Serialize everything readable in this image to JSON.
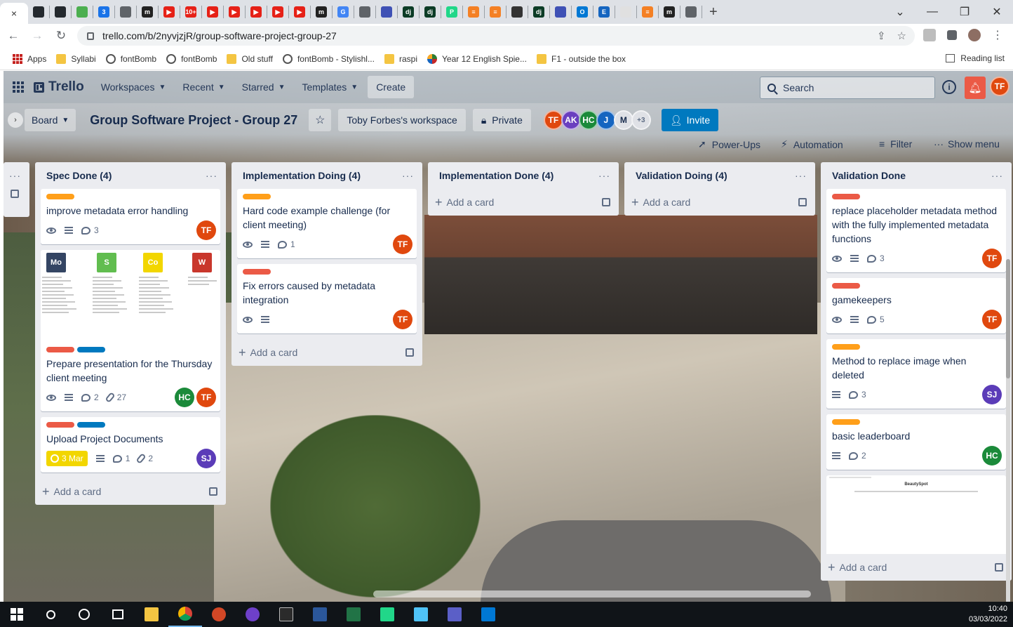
{
  "browser": {
    "active_tab_close": "×",
    "new_tab": "+",
    "window_controls": [
      "⌄",
      "—",
      "❐",
      "✕"
    ],
    "url": "trello.com/b/2nyvjzjR/group-software-project-group-27",
    "tab_icons": [
      {
        "name": "github-icon",
        "color": "#24292e",
        "text": ""
      },
      {
        "name": "github-icon",
        "color": "#24292e",
        "text": ""
      },
      {
        "name": "chrome-icon",
        "color": "#4caf50",
        "text": ""
      },
      {
        "name": "calendar-icon",
        "color": "#1a73e8",
        "text": "3"
      },
      {
        "name": "globe-icon",
        "color": "#5f6368",
        "text": ""
      },
      {
        "name": "medium-icon",
        "color": "#222222",
        "text": "m"
      },
      {
        "name": "youtube-icon",
        "color": "#e62117",
        "text": "▶"
      },
      {
        "name": "youtube-badge-icon",
        "color": "#e62117",
        "text": "10+"
      },
      {
        "name": "youtube-icon",
        "color": "#e62117",
        "text": "▶"
      },
      {
        "name": "youtube-icon",
        "color": "#e62117",
        "text": "▶"
      },
      {
        "name": "youtube-icon",
        "color": "#e62117",
        "text": "▶"
      },
      {
        "name": "youtube-icon",
        "color": "#e62117",
        "text": "▶"
      },
      {
        "name": "youtube-icon",
        "color": "#e62117",
        "text": "▶"
      },
      {
        "name": "medium-icon",
        "color": "#222222",
        "text": "m"
      },
      {
        "name": "google-icon",
        "color": "#4285f4",
        "text": "G"
      },
      {
        "name": "globe-icon",
        "color": "#5f6368",
        "text": ""
      },
      {
        "name": "settings-icon",
        "color": "#3f51b5",
        "text": ""
      },
      {
        "name": "django-icon",
        "color": "#0c3c26",
        "text": "dj"
      },
      {
        "name": "django-icon",
        "color": "#0c3c26",
        "text": "dj"
      },
      {
        "name": "pycharm-icon",
        "color": "#21d789",
        "text": "P"
      },
      {
        "name": "stackoverflow-icon",
        "color": "#f48024",
        "text": "≡"
      },
      {
        "name": "stackoverflow-icon",
        "color": "#f48024",
        "text": "≡"
      },
      {
        "name": "openai-icon",
        "color": "#333333",
        "text": ""
      },
      {
        "name": "django-icon",
        "color": "#0c3c26",
        "text": "dj"
      },
      {
        "name": "settings-icon",
        "color": "#3f51b5",
        "text": ""
      },
      {
        "name": "outlook-icon",
        "color": "#0078d4",
        "text": "O"
      },
      {
        "name": "e-icon",
        "color": "#1565c0",
        "text": "E"
      },
      {
        "name": "blank-page-icon",
        "color": "#e0e0e0",
        "text": ""
      },
      {
        "name": "stackoverflow-icon",
        "color": "#f48024",
        "text": "≡"
      },
      {
        "name": "medium-icon",
        "color": "#222222",
        "text": "m"
      },
      {
        "name": "globe-icon",
        "color": "#5f6368",
        "text": ""
      }
    ],
    "bookmarks": [
      {
        "icon": "apps",
        "label": "Apps"
      },
      {
        "icon": "folder",
        "label": "Syllabi"
      },
      {
        "icon": "globe",
        "label": "fontBomb"
      },
      {
        "icon": "globe",
        "label": "fontBomb"
      },
      {
        "icon": "folder",
        "label": "Old stuff"
      },
      {
        "icon": "globe",
        "label": "fontBomb - Stylishl..."
      },
      {
        "icon": "folder",
        "label": "raspi"
      },
      {
        "icon": "pinwheel",
        "label": "Year 12 English Spie..."
      },
      {
        "icon": "folder",
        "label": "F1 - outside the box"
      }
    ],
    "reading_list": "Reading list"
  },
  "trello": {
    "logo": "Trello",
    "nav": [
      "Workspaces",
      "Recent",
      "Starred",
      "Templates"
    ],
    "create": "Create",
    "search_placeholder": "Search",
    "info": "i",
    "user_initials": "TF",
    "board": {
      "view": "Board",
      "title": "Group Software Project - Group 27",
      "star": "☆",
      "workspace": "Toby Forbes's workspace",
      "visibility": "Private",
      "members": [
        {
          "initials": "TF",
          "color": "#e0480e"
        },
        {
          "initials": "AK",
          "color": "#6a3fbf"
        },
        {
          "initials": "HC",
          "color": "#1b8a3a"
        },
        {
          "initials": "J",
          "color": "#1565c0"
        },
        {
          "initials": "M",
          "color": "#dfe1e6"
        }
      ],
      "more_members": "+3",
      "invite": "Invite",
      "power_ups": "Power-Ups",
      "automation": "Automation",
      "filter": "Filter",
      "show_menu": "Show menu"
    },
    "add_card": "Add a card",
    "lists": [
      {
        "title": "Spec Done (4)",
        "cards": [
          {
            "labels": [
              "#ff9f1a"
            ],
            "title": "improve metadata error handling",
            "watch": true,
            "desc": true,
            "comments": "3",
            "members": [
              "TF"
            ]
          },
          {
            "labels": [
              "#eb5a46",
              "#0079bf"
            ],
            "title": "Prepare presentation for the Thursday client meeting",
            "cover": "moscow",
            "watch": true,
            "desc": true,
            "comments": "2",
            "attachments": "27",
            "members": [
              "HC",
              "TF"
            ],
            "moscow": [
              {
                "text": "Mo",
                "color": "#344563"
              },
              {
                "text": "S",
                "color": "#61bd4f"
              },
              {
                "text": "Co",
                "color": "#f2d600"
              },
              {
                "text": "W",
                "color": "#c9372c"
              }
            ]
          },
          {
            "labels": [
              "#eb5a46",
              "#0079bf"
            ],
            "title": "Upload Project Documents",
            "due": "3 Mar",
            "desc": true,
            "comments": "1",
            "attachments": "2",
            "members": [
              "SJ"
            ]
          }
        ]
      },
      {
        "title": "Implementation Doing (4)",
        "cards": [
          {
            "labels": [
              "#ff9f1a"
            ],
            "title": "Hard code example challenge (for client meeting)",
            "watch": true,
            "desc": true,
            "comments": "1",
            "members": [
              "TF"
            ]
          },
          {
            "labels": [
              "#eb5a46"
            ],
            "title": "Fix errors caused by metadata integration",
            "watch": true,
            "desc": true,
            "members": [
              "TF"
            ]
          }
        ]
      },
      {
        "title": "Implementation Done (4)",
        "cards": []
      },
      {
        "title": "Validation Doing (4)",
        "cards": []
      },
      {
        "title": "Validation Done",
        "cards": [
          {
            "labels": [
              "#eb5a46"
            ],
            "title": "replace placeholder metadata method with the fully implemented metadata functions",
            "watch": true,
            "desc": true,
            "comments": "3",
            "members": [
              "TF"
            ]
          },
          {
            "labels": [
              "#eb5a46"
            ],
            "title": "gamekeepers",
            "watch": true,
            "desc": true,
            "comments": "5",
            "members": [
              "TF"
            ]
          },
          {
            "labels": [
              "#ff9f1a"
            ],
            "title": "Method to replace image when deleted",
            "desc": true,
            "comments": "3",
            "members": [
              "SJ"
            ]
          },
          {
            "labels": [
              "#ff9f1a"
            ],
            "title": "basic leaderboard",
            "desc": true,
            "comments": "2",
            "members": [
              "HC"
            ]
          }
        ],
        "cover_title": "BeautySpot"
      }
    ],
    "member_colors": {
      "TF": "#e0480e",
      "HC": "#1b8a3a",
      "SJ": "#5b3cb8"
    }
  },
  "taskbar": {
    "time": "10:40",
    "date": "03/03/2022"
  }
}
